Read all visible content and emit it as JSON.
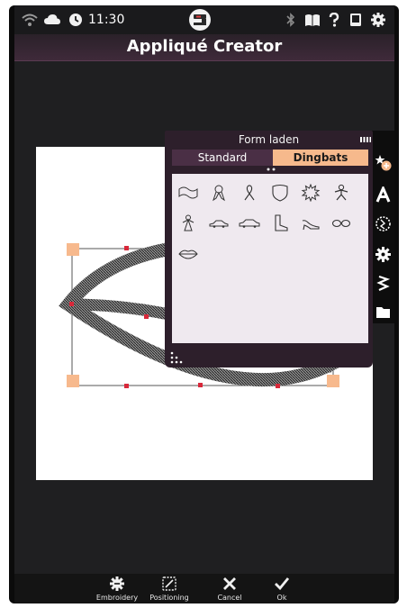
{
  "status_bar": {
    "time": "11:30",
    "left_icons": [
      "wifi-icon",
      "cloud-icon",
      "clock-icon"
    ],
    "right_icons": [
      "bluetooth-icon",
      "book-icon",
      "help-icon",
      "tablet-icon",
      "gear-icon"
    ],
    "center_icon": "sewing-machine-icon"
  },
  "header": {
    "title": "Appliqué Creator"
  },
  "panel": {
    "title": "Form laden",
    "tabs": [
      {
        "label": "Standard",
        "active": false
      },
      {
        "label": "Dingbats",
        "active": true
      }
    ],
    "shapes": [
      "banner-shape",
      "ribbon-shape",
      "awareness-ribbon-shape",
      "shield-shape",
      "starburst-shape",
      "gingerbread-man-shape",
      "angel-shape",
      "car-shape",
      "sedan-shape",
      "boot-shape",
      "high-heel-shape",
      "glasses-shape",
      "lips-shape"
    ]
  },
  "right_toolbar": [
    "shapes-add-icon",
    "text-icon",
    "stitch-icon",
    "gear-icon",
    "zigzag-icon",
    "folder-icon"
  ],
  "bottom_bar": {
    "items": [
      {
        "label": "Embroidery",
        "icon": "embroidery-icon"
      },
      {
        "label": "Positioning",
        "icon": "positioning-icon"
      },
      {
        "label": "Cancel",
        "icon": "close-icon"
      },
      {
        "label": "Ok",
        "icon": "check-icon"
      }
    ]
  },
  "colors": {
    "accent": "#f6b98c",
    "panel": "#2d1f2b",
    "title_bar": "#3f2a3a",
    "handle": "#f7b98d",
    "handle_point": "#d8283a"
  }
}
